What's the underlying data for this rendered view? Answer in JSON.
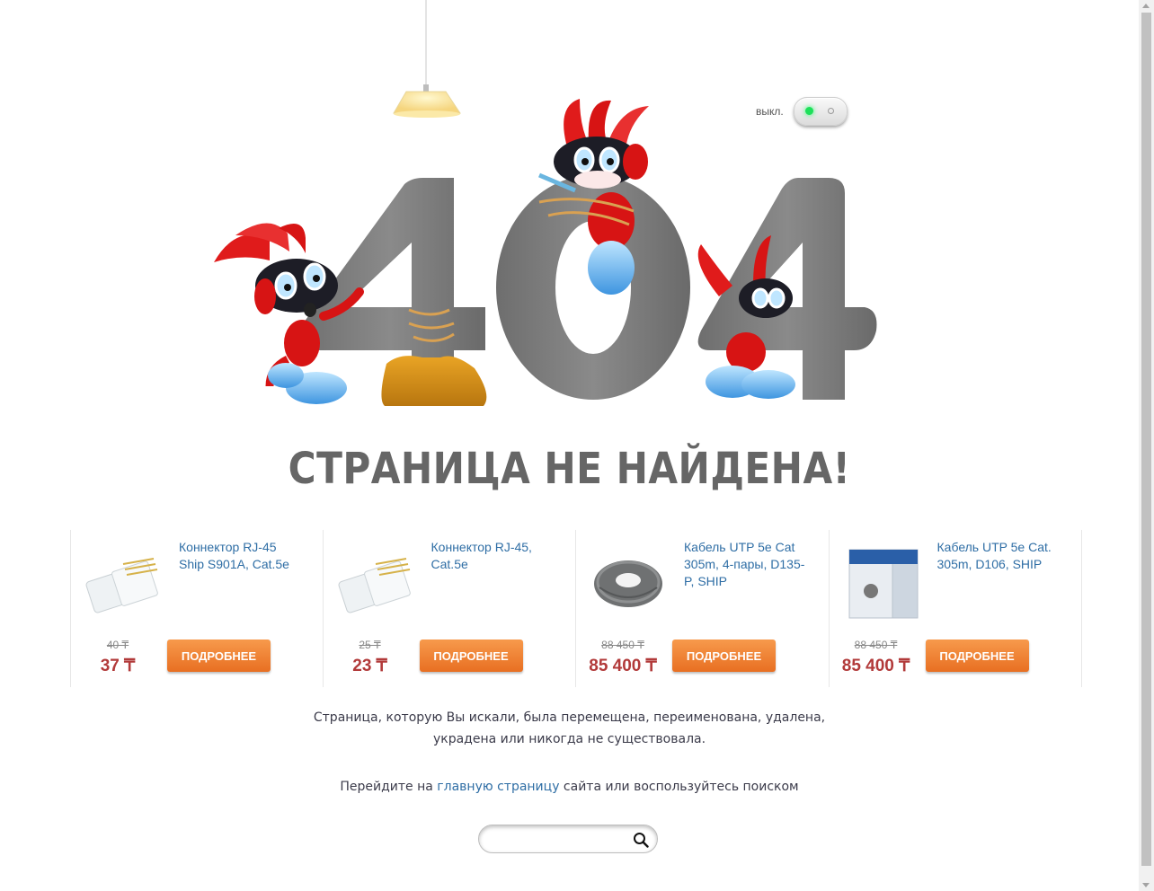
{
  "switch": {
    "label": "выкл."
  },
  "hero": {
    "digits": "404"
  },
  "heading": "СТРАНИЦА НЕ НАЙДЕНА!",
  "products": [
    {
      "name": "Коннектор RJ-45 Ship S901A, Cat.5e",
      "old_price": "40 ₸",
      "price": "37 ₸",
      "button": "ПОДРОБНЕЕ",
      "image": "rj45-connector-icon"
    },
    {
      "name": "Коннектор RJ-45, Cat.5e",
      "old_price": "25 ₸",
      "price": "23 ₸",
      "button": "ПОДРОБНЕЕ",
      "image": "rj45-connector-icon"
    },
    {
      "name": "Кабель UTP 5e Cat 305m, 4-пары, D135-P, SHIP",
      "old_price": "88 450 ₸",
      "price": "85 400 ₸",
      "button": "ПОДРОБНЕЕ",
      "image": "cable-coil-icon"
    },
    {
      "name": "Кабель UTP 5e Cat. 305m, D106, SHIP",
      "old_price": "88 450 ₸",
      "price": "85 400 ₸",
      "button": "ПОДРОБНЕЕ",
      "image": "cable-box-icon"
    }
  ],
  "message": {
    "line1": "Страница, которую Вы искали, была перемещена, переименована, удалена,",
    "line2": "украдена или никогда не существовала.",
    "go_prefix": "Перейдите на ",
    "home_link": "главную страницу",
    "go_suffix": " сайта или воспользуйтесь поиском"
  },
  "search": {
    "placeholder": "",
    "value": ""
  },
  "colors": {
    "accent": "#e86f22",
    "price": "#b23a3a",
    "link": "#2f6ea5",
    "digits": "#777777",
    "mascot": "#e01b1b"
  }
}
